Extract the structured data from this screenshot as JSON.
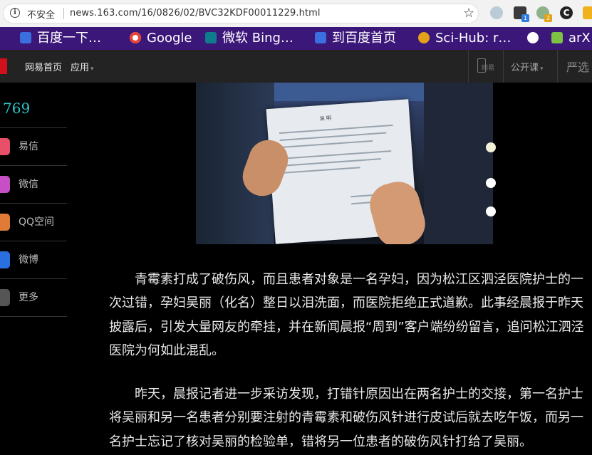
{
  "browser": {
    "security_label": "不安全",
    "url": "news.163.com/16/0826/02/BVC32KDF00011229.html",
    "ext_badge_1": "1",
    "ext_badge_2": "2",
    "ext_letter": "C"
  },
  "bookmarks": [
    {
      "label": "百度一下…",
      "icon": "baidu-icon"
    },
    {
      "label": "Google",
      "icon": "google-icon"
    },
    {
      "label": "微软 Bing…",
      "icon": "bing-icon"
    },
    {
      "label": "到百度首页",
      "icon": "baidu-icon"
    },
    {
      "label": "Sci-Hub: r…",
      "icon": "scihub-icon"
    },
    {
      "label": "",
      "icon": "globe-icon"
    },
    {
      "label": "arX",
      "icon": "arxiv-icon"
    }
  ],
  "site_nav": {
    "home": "网易首页",
    "apps": "应用",
    "phone_label": "网易",
    "open_course": "公开课",
    "yanxuan": "严选"
  },
  "sidebar": {
    "count": "769",
    "share_items": [
      "易信",
      "微信",
      "QQ空间",
      "微博",
      "更多"
    ]
  },
  "article": {
    "paragraphs": [
      "青霉素打成了破伤风，而且患者对象是一名孕妇，因为松江区泗泾医院护士的一次过错，孕妇吴丽（化名）整日以泪洗面，而医院拒绝正式道歉。此事经晨报于昨天披露后，引发大量网友的牵挂，并在新闻晨报“周到”客户端纷纷留言，追问松江泗泾医院为何如此混乱。",
      "昨天，晨报记者进一步采访发现，打错针原因出在两名护士的交接，第一名护士将吴丽和另一名患者分别要注射的青霉素和破伤风针进行皮试后就去吃午饭，而另一名护士忘记了核对吴丽的检验单，错将另一位患者的破伤风针打给了吴丽。"
    ],
    "photo_document_title": "说 明"
  }
}
